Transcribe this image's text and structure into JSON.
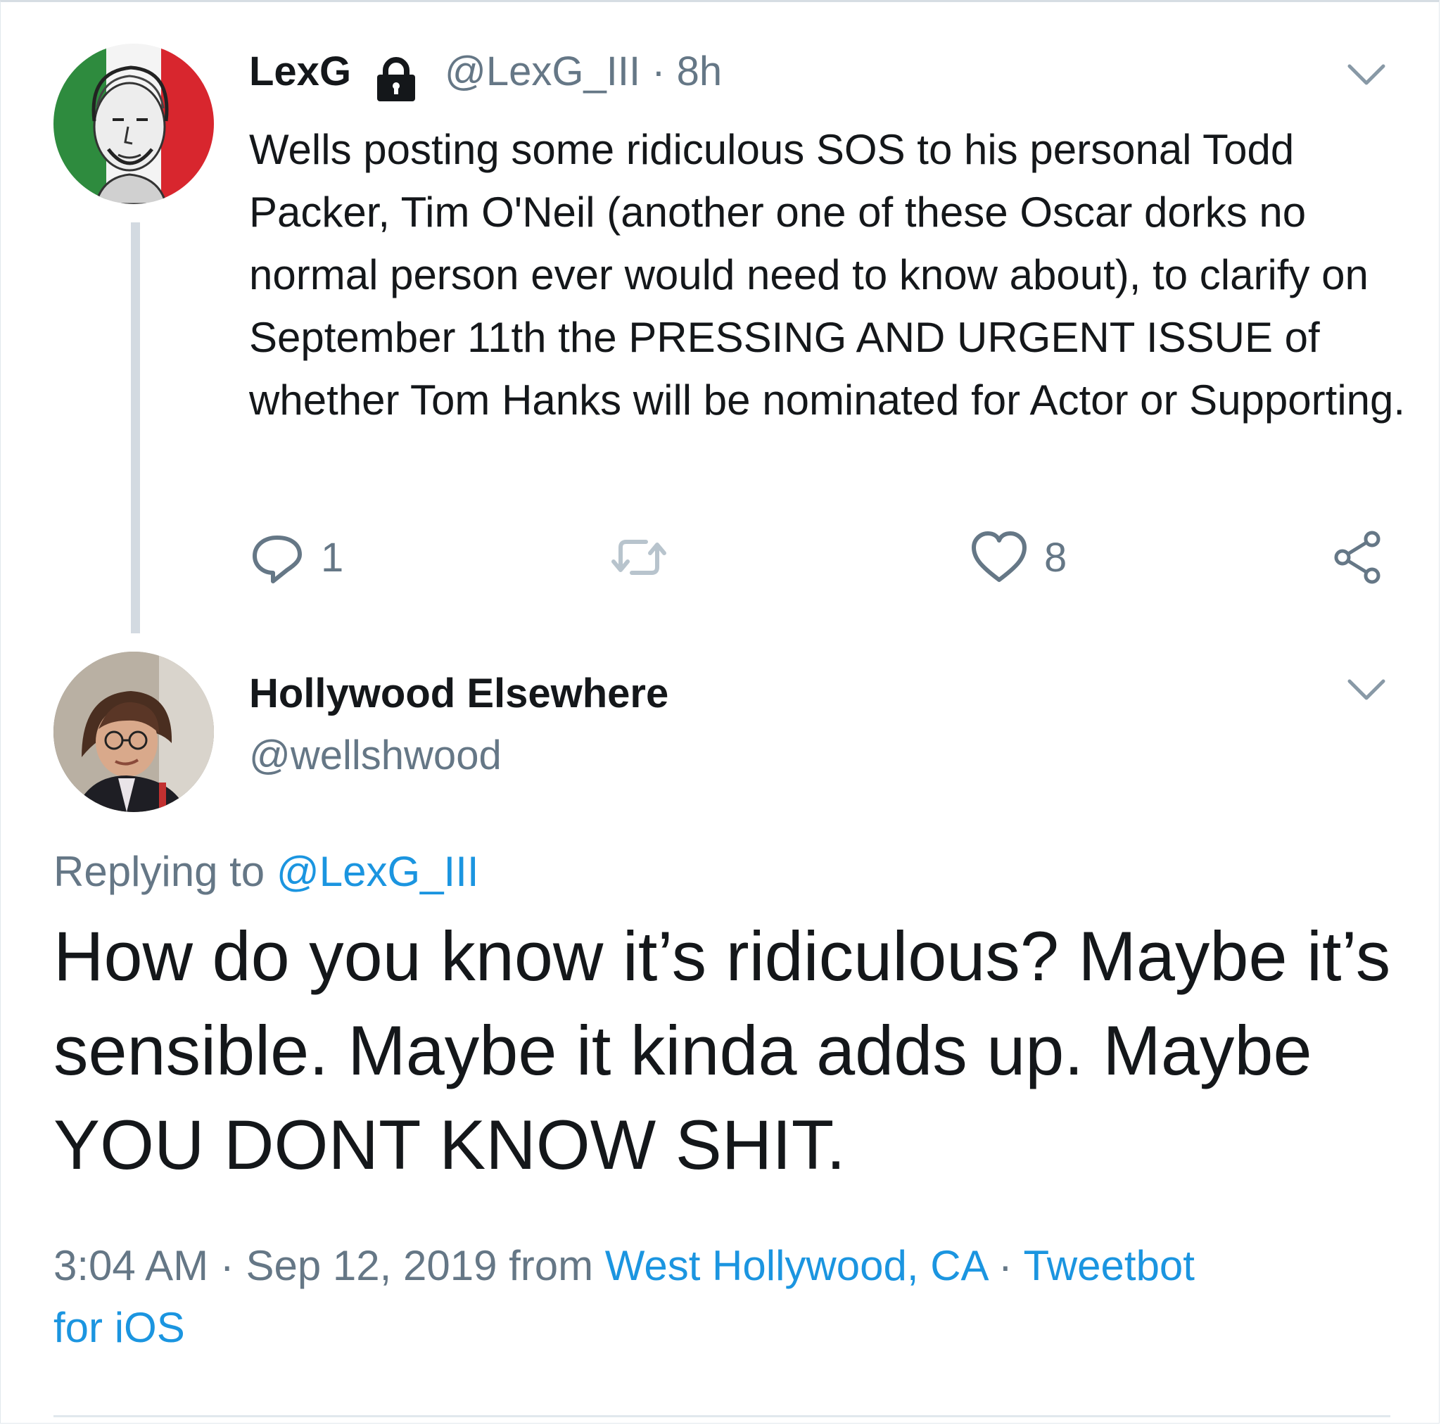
{
  "parent_tweet": {
    "author_name": "LexG",
    "handle": "@LexG_III",
    "time": "· 8h",
    "text": "Wells posting some ridiculous SOS to his personal Todd Packer, Tim O'Neil (another one of these Oscar dorks no normal person ever would need to know about), to clarify on September 11th the PRESSING AND URGENT ISSUE of whether Tom Hanks will be nominated for Actor or Supporting.",
    "reply_count": "1",
    "like_count": "8",
    "icons": {
      "reply": "reply-icon",
      "retweet": "retweet-icon",
      "like": "heart-icon",
      "share": "share-icon",
      "protected": "lock-icon",
      "menu": "chevron-down-icon"
    }
  },
  "reply_tweet": {
    "author_name": "Hollywood Elsewhere",
    "handle": "@wellshwood",
    "replying_prefix": "Replying to",
    "replying_handle": "@LexG_III",
    "text": "How do you know it’s ridiculous?  Maybe it’s sensible.  Maybe it kinda adds up.  Maybe YOU DONT KNOW SHIT.",
    "timestamp": "3:04 AM · Sep 12, 2019",
    "from_word": "from",
    "location": "West Hollywood, CA",
    "separator": "·",
    "client": "Tweetbot for iOS"
  },
  "colors": {
    "text": "#14171a",
    "secondary": "#657786",
    "link": "#1b95e0",
    "thread_line": "#d3dae1"
  }
}
